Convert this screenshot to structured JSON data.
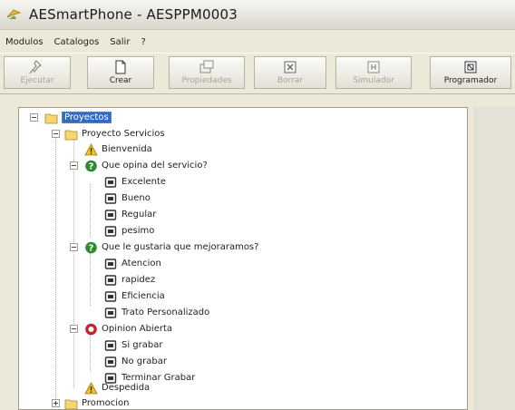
{
  "window": {
    "title": "AESmartPhone - AESPPM0003"
  },
  "menu": [
    "Modulos",
    "Catalogos",
    "Salir",
    "?"
  ],
  "toolbar": [
    {
      "label": "Ejecutar",
      "icon": "pin-icon",
      "enabled": false
    },
    {
      "label": "Crear",
      "icon": "new-document-icon",
      "enabled": true
    },
    {
      "label": "Propiedades",
      "icon": "properties-icon",
      "enabled": false
    },
    {
      "label": "Borrar",
      "icon": "delete-icon",
      "enabled": false
    },
    {
      "label": "Simulador",
      "icon": "simulator-icon",
      "enabled": false
    },
    {
      "label": "Programador",
      "icon": "programmer-icon",
      "enabled": true
    }
  ],
  "tree": [
    {
      "label": "Proyectos",
      "icon": "folder-icon",
      "selected": true
    },
    {
      "label": "Proyecto Servicios",
      "icon": "folder-icon"
    },
    {
      "label": "Bienvenida",
      "icon": "warning-icon"
    },
    {
      "label": "Que opina del servicio?",
      "icon": "question-icon"
    },
    {
      "label": "Excelente",
      "icon": "option-icon"
    },
    {
      "label": "Bueno",
      "icon": "option-icon"
    },
    {
      "label": "Regular",
      "icon": "option-icon"
    },
    {
      "label": "pesimo",
      "icon": "option-icon"
    },
    {
      "label": "Que le gustaria que mejoraramos?",
      "icon": "question-icon"
    },
    {
      "label": "Atencion",
      "icon": "option-icon"
    },
    {
      "label": "rapidez",
      "icon": "option-icon"
    },
    {
      "label": "Eficiencia",
      "icon": "option-icon"
    },
    {
      "label": "Trato Personalizado",
      "icon": "option-icon"
    },
    {
      "label": "Opinion Abierta",
      "icon": "record-icon"
    },
    {
      "label": "Si grabar",
      "icon": "option-icon"
    },
    {
      "label": "No grabar",
      "icon": "option-icon"
    },
    {
      "label": "Terminar Grabar",
      "icon": "option-icon"
    },
    {
      "label": "Despedida",
      "icon": "warning-icon"
    },
    {
      "label": "Promocion",
      "icon": "folder-icon"
    }
  ],
  "colors": {
    "selection": "#316ac5",
    "question": "#2e8b2e",
    "record": "#c0262c",
    "warning": "#f0c419",
    "folder": "#f5d76e"
  }
}
